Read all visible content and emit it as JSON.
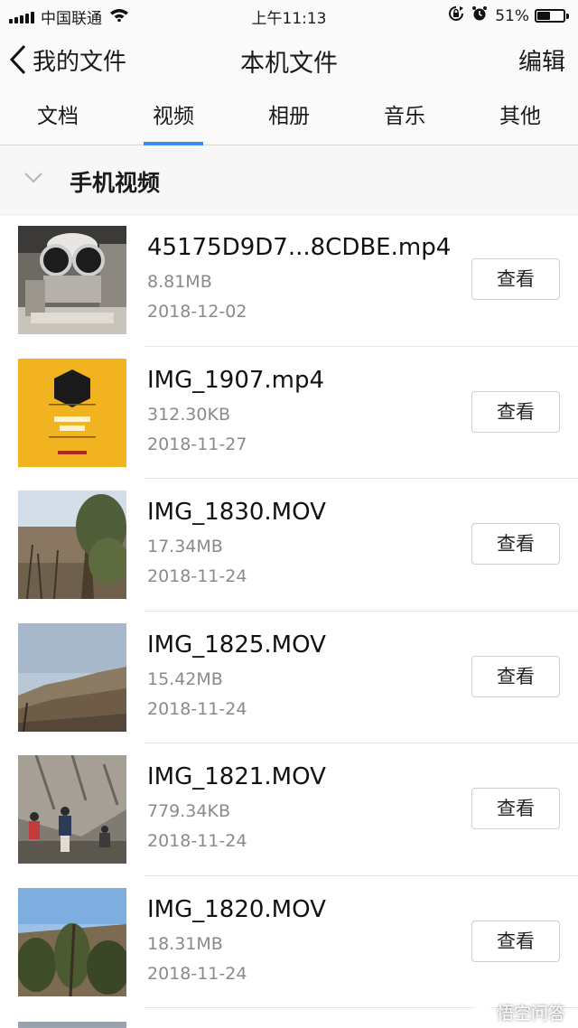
{
  "status_bar": {
    "carrier": "中国联通",
    "time": "上午11:13",
    "battery_percent": "51%",
    "battery_level": 0.51,
    "icons": [
      "signal-icon",
      "wifi-icon",
      "rotation-lock-icon",
      "alarm-icon",
      "battery-icon"
    ]
  },
  "nav": {
    "back_label": "我的文件",
    "title": "本机文件",
    "edit_label": "编辑"
  },
  "tabs": [
    {
      "label": "文档",
      "active": false
    },
    {
      "label": "视频",
      "active": true
    },
    {
      "label": "相册",
      "active": false
    },
    {
      "label": "音乐",
      "active": false
    },
    {
      "label": "其他",
      "active": false
    }
  ],
  "section": {
    "title": "手机视频"
  },
  "files": [
    {
      "name": "45175D9D7...8CDBE.mp4",
      "size": "8.81MB",
      "date": "2018-12-02",
      "button": "查看"
    },
    {
      "name": "IMG_1907.mp4",
      "size": "312.30KB",
      "date": "2018-11-27",
      "button": "查看"
    },
    {
      "name": "IMG_1830.MOV",
      "size": "17.34MB",
      "date": "2018-11-24",
      "button": "查看"
    },
    {
      "name": "IMG_1825.MOV",
      "size": "15.42MB",
      "date": "2018-11-24",
      "button": "查看"
    },
    {
      "name": "IMG_1821.MOV",
      "size": "779.34KB",
      "date": "2018-11-24",
      "button": "查看"
    },
    {
      "name": "IMG_1820.MOV",
      "size": "18.31MB",
      "date": "2018-11-24",
      "button": "查看"
    }
  ],
  "watermark": "悟空问答",
  "colors": {
    "accent": "#3a8ee6",
    "secondary_text": "#8a8a8a",
    "thumb2_bg": "#f2b320"
  }
}
